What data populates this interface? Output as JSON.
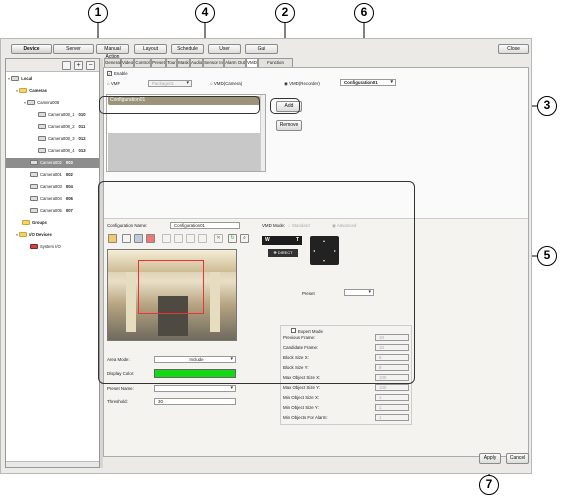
{
  "toolbar": {
    "device": "Device",
    "server": "Server",
    "manual_action": "Manual Action",
    "layout": "Layout",
    "schedule": "Schedule",
    "user": "User",
    "gui": "Gui",
    "close": "Close"
  },
  "tabs": [
    "General",
    "Video",
    "Control",
    "Preset",
    "Tour",
    "Mask",
    "Audio",
    "Sensor In",
    "Alarm Out",
    "VMD",
    "Function Selection"
  ],
  "tree": [
    {
      "label": "Local",
      "num": ""
    },
    {
      "label": "Cameras",
      "num": ""
    },
    {
      "label": "Camera008",
      "num": ""
    },
    {
      "label": "Camera008_1",
      "num": "010"
    },
    {
      "label": "Camera008_2",
      "num": "011"
    },
    {
      "label": "Camera008_3",
      "num": "012"
    },
    {
      "label": "Camera008_4",
      "num": "013"
    },
    {
      "label": "Camera002",
      "num": "003"
    },
    {
      "label": "Camera001",
      "num": "002"
    },
    {
      "label": "Camera003",
      "num": "004"
    },
    {
      "label": "Camera004",
      "num": "006"
    },
    {
      "label": "Camera005",
      "num": "007"
    },
    {
      "label": "Groups",
      "num": ""
    },
    {
      "label": "I/O Devices",
      "num": ""
    },
    {
      "label": "System I/O",
      "num": ""
    }
  ],
  "vmd": {
    "enable": "Enable",
    "vmf": "VMF",
    "package": "Package01",
    "vmd_camera": "VMD(Camera)",
    "vmd_recorder": "VMD(Recorder)",
    "config_select": "Configuration01",
    "list_item": "Configuration01",
    "add": "Add",
    "remove": "Remove"
  },
  "config": {
    "name_label": "Configuration Name:",
    "name_value": "Configuration01",
    "mode_label": "VMD Mode:",
    "standard": "Standard",
    "advanced": "Advanced",
    "w": "W",
    "t": "T",
    "direct": "DIRECT",
    "preset_label": "Preset",
    "area_mode_label": "Area Mode:",
    "area_mode_value": "Include",
    "display_color_label": "Display Color:",
    "display_color": "#14d814",
    "preset_name_label": "Preset Name:",
    "threshold_label": "Threshold:",
    "threshold_value": "30"
  },
  "expert": {
    "title": "Expert Mode",
    "fields": [
      "Previous Frame:",
      "Candidate Frame:",
      "Block Size X:",
      "Block Size Y:",
      "Max Object Size X:",
      "Max Object Size Y:",
      "Min Object Size X:",
      "Min Object Size Y:",
      "Min Objects For Alarm:"
    ],
    "values": [
      "10",
      "10",
      "8",
      "8",
      "100",
      "100",
      "1",
      "1",
      "1"
    ]
  },
  "footer": {
    "apply": "Apply",
    "cancel": "Cancel"
  },
  "callouts": [
    "1",
    "2",
    "3",
    "4",
    "5",
    "6",
    "7"
  ]
}
